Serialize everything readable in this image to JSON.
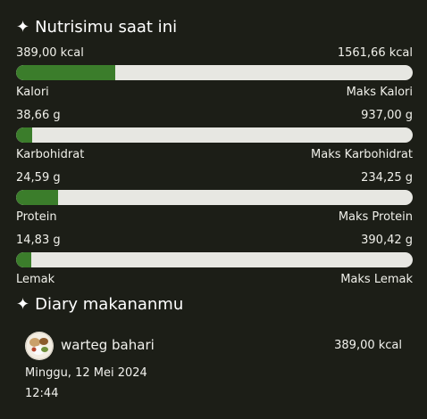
{
  "nutrition": {
    "title": "Nutrisimu saat ini",
    "title_icon": "sparkle-icon",
    "items": [
      {
        "current": "389,00 kcal",
        "max": "1561,66 kcal",
        "label": "Kalori",
        "max_label": "Maks Kalori",
        "progress": 0.2491
      },
      {
        "current": "38,66 g",
        "max": "937,00 g",
        "label": "Karbohidrat",
        "max_label": "Maks Karbohidrat",
        "progress": 0.0413
      },
      {
        "current": "24,59 g",
        "max": "234,25 g",
        "label": "Protein",
        "max_label": "Maks Protein",
        "progress": 0.105
      },
      {
        "current": "14,83 g",
        "max": "390,42 g",
        "label": "Lemak",
        "max_label": "Maks Lemak",
        "progress": 0.038
      }
    ],
    "fill_color": "#3b7d2b",
    "track_color": "#e7e7e2"
  },
  "diary": {
    "title": "Diary makananmu",
    "title_icon": "sparkle-icon",
    "entries": [
      {
        "image_icon": "food-thumbnail-icon",
        "name": "warteg bahari",
        "calories": "389,00 kcal",
        "date": "Minggu, 12 Mei 2024",
        "time": "12:44"
      }
    ]
  },
  "background_color": "#1c1e17"
}
